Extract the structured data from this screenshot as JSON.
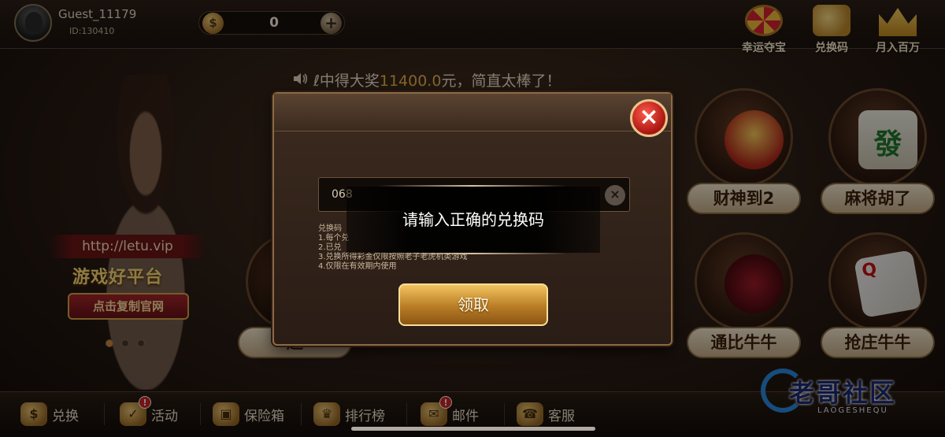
{
  "user": {
    "name": "Guest_11179",
    "id": "ID:130410"
  },
  "balance": {
    "value": "0",
    "coin_symbol": "$",
    "add_symbol": "+"
  },
  "top_menu": [
    {
      "label": "幸运夺宝",
      "icon": "prize-wheel-icon"
    },
    {
      "label": "兑换码",
      "icon": "redeem-code-icon"
    },
    {
      "label": "月入百万",
      "icon": "crown-icon"
    }
  ],
  "marquee": {
    "prefix": "ℓ中得大奖",
    "amount": "11400.0",
    "suffix": "元，简直太棒了！"
  },
  "promo": {
    "url": "http://letu.vip",
    "title": "游戏好平台",
    "button": "点击复制官网"
  },
  "games": [
    {
      "label": "财神到2",
      "icon": "god-of-wealth-icon"
    },
    {
      "label": "麻将胡了",
      "icon": "mahjong-icon"
    },
    {
      "label": "通比牛牛",
      "icon": "bull-icon"
    },
    {
      "label": "抢庄牛牛",
      "icon": "poker-card-icon"
    },
    {
      "label": "超",
      "icon": "slot-machine-icon"
    }
  ],
  "bottom_nav": [
    {
      "label": "兑换",
      "badge": ""
    },
    {
      "label": "活动",
      "badge": "!"
    },
    {
      "label": "保险箱",
      "badge": ""
    },
    {
      "label": "排行榜",
      "badge": ""
    },
    {
      "label": "邮件",
      "badge": "!"
    },
    {
      "label": "客服",
      "badge": ""
    }
  ],
  "watermark": {
    "text": "老哥社区",
    "sub": "LAOGESHEQU"
  },
  "dialog": {
    "input_value": "068",
    "notes": [
      "兑换码",
      "1.每个兑",
      "2.已兑",
      "3.兑换所得彩金仅限按照老子老虎机类游戏",
      "4.仅限在有效期内使用"
    ],
    "claim_button": "领取",
    "close_symbol": "×",
    "clear_symbol": "×"
  },
  "toast": {
    "message": "请输入正确的兑换码"
  },
  "colors": {
    "accent_gold": "#f2b84a",
    "close_red": "#d32323",
    "panel_brown": "#2a1d15"
  }
}
